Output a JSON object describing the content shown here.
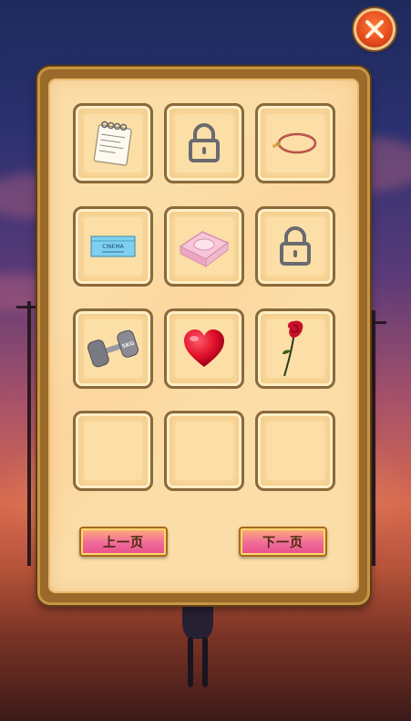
{
  "screen": "inventory-panel",
  "close_button": {
    "icon": "close-icon"
  },
  "grid": {
    "rows": [
      [
        {
          "item": "notepad",
          "icon": "notepad-icon",
          "locked": false
        },
        {
          "item": "locked",
          "icon": "lock-icon",
          "locked": true
        },
        {
          "item": "bracelet",
          "icon": "bracelet-icon",
          "locked": false
        }
      ],
      [
        {
          "item": "cinema-ticket",
          "icon": "ticket-icon",
          "locked": false,
          "text": "CINEMA"
        },
        {
          "item": "soap",
          "icon": "soap-icon",
          "locked": false
        },
        {
          "item": "locked",
          "icon": "lock-icon",
          "locked": true
        }
      ],
      [
        {
          "item": "dumbbell",
          "icon": "dumbbell-icon",
          "locked": false,
          "text": "5KG"
        },
        {
          "item": "heart",
          "icon": "heart-icon",
          "locked": false
        },
        {
          "item": "rose",
          "icon": "rose-icon",
          "locked": false
        }
      ],
      [
        {
          "item": "empty",
          "icon": "",
          "locked": false
        },
        {
          "item": "empty",
          "icon": "",
          "locked": false
        },
        {
          "item": "empty",
          "icon": "",
          "locked": false
        }
      ]
    ]
  },
  "pagination": {
    "prev_label": "上一页",
    "next_label": "下一页"
  },
  "colors": {
    "panel": "#fbdda8",
    "slot_border": "#8a6a3a",
    "button_gradient_top": "#ffb07a",
    "button_gradient_bottom": "#e84f88",
    "close_button": "#e34a1c",
    "heart": "#e0102a",
    "lock": "#6a6a70"
  }
}
